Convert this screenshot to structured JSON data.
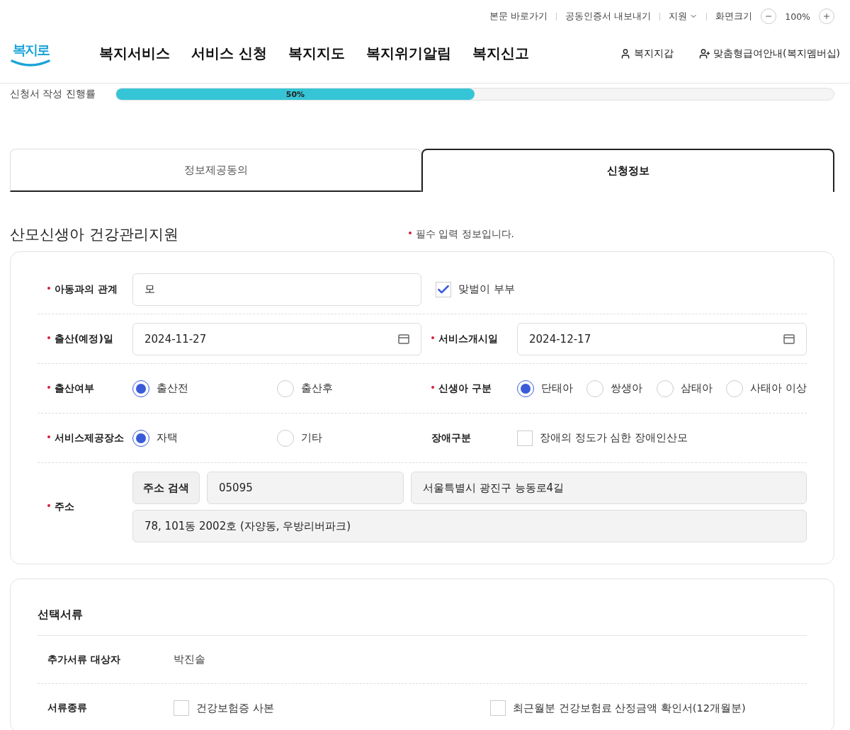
{
  "utility_links": [
    {
      "label": "본문 바로가기",
      "kind": "link"
    },
    {
      "label": "공동인증서 내보내기",
      "kind": "link"
    },
    {
      "label": "지원",
      "kind": "dropdown"
    },
    {
      "label": "화면크기",
      "kind": "text"
    }
  ],
  "zoom": {
    "value": "100%"
  },
  "logo": "복지로",
  "nav": [
    "복지서비스",
    "서비스 신청",
    "복지지도",
    "복지위기알림",
    "복지신고"
  ],
  "user_links": [
    {
      "label": "복지지갑",
      "kind": "user"
    },
    {
      "label": "맞춤형급여안내(복지멤버십)",
      "kind": "user-plus"
    }
  ],
  "progress": {
    "label": "신청서 작성 진행률",
    "level": 0.5,
    "reading": "50%"
  },
  "tabs": [
    {
      "label": "정보제공동의",
      "selected": false
    },
    {
      "label": "신청정보",
      "selected": true
    }
  ],
  "title": "산모신생아 건강관리지원",
  "required_note": "필수 입력 정보입니다.",
  "form_rows": [
    [
      {
        "kind": "text",
        "label": "아동과의 관계",
        "required": true,
        "value": "모"
      },
      {
        "kind": "check",
        "label": "맞벌이 부부",
        "checked": true
      }
    ],
    [
      {
        "kind": "date",
        "label": "출산(예정)일",
        "required": true,
        "value": "2024-11-27"
      },
      {
        "kind": "date",
        "label": "서비스개시일",
        "required": true,
        "value": "2024-12-17"
      }
    ],
    [
      {
        "kind": "radio",
        "label": "출산여부",
        "required": true,
        "options": [
          {
            "label": "출산전",
            "selected": true
          },
          {
            "label": "출산후",
            "selected": false
          }
        ]
      },
      {
        "kind": "radio",
        "label": "신생아 구분",
        "required": true,
        "options": [
          {
            "label": "단태아",
            "selected": true
          },
          {
            "label": "쌍생아",
            "selected": false
          },
          {
            "label": "삼태아",
            "selected": false
          },
          {
            "label": "사태아 이상",
            "selected": false
          }
        ]
      }
    ],
    [
      {
        "kind": "radio",
        "label": "서비스제공장소",
        "required": true,
        "options": [
          {
            "label": "자택",
            "selected": true
          },
          {
            "label": "기타",
            "selected": false
          }
        ]
      },
      {
        "kind": "labeled_check",
        "label": "장애구분",
        "required": false,
        "option": {
          "label": "장애의 정도가 심한 장애인산모",
          "checked": false
        }
      }
    ],
    [
      {
        "kind": "address",
        "label": "주소",
        "required": true,
        "button": "주소 검색",
        "zip": "05095",
        "road": "서울특별시 광진구 능동로4길",
        "detail": "78, 101동 2002호 (자양동, 우방리버파크)"
      }
    ]
  ],
  "documents": {
    "title": "선택서류",
    "rows": [
      {
        "kind": "text",
        "label": "추가서류 대상자",
        "value": "박진솔"
      },
      {
        "kind": "checks",
        "label": "서류종류",
        "options": [
          {
            "label": "건강보험증 사본",
            "checked": false
          },
          {
            "label": "최근월분 건강보험료 산정금액 확인서(12개월분)",
            "checked": false
          }
        ]
      }
    ]
  }
}
